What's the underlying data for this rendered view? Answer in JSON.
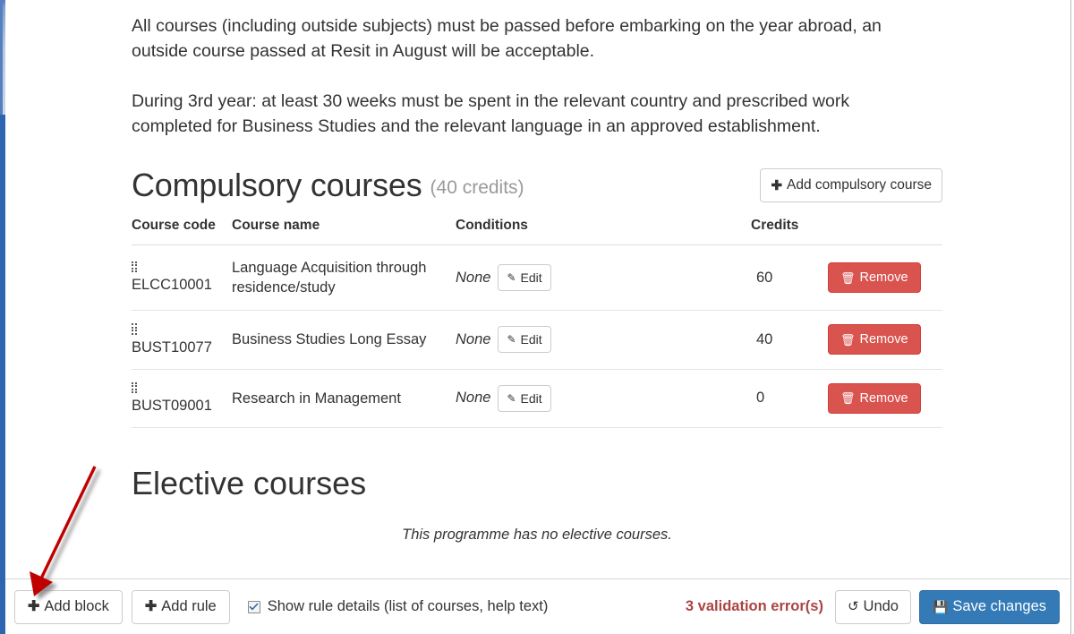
{
  "paragraphs": [
    "All courses (including outside subjects) must be passed before embarking on the year abroad, an outside course passed at Resit in August will be acceptable.",
    "During 3rd year: at least 30 weeks must be spent in the relevant country and prescribed work completed for Business Studies and the relevant language in an approved establishment."
  ],
  "compulsory": {
    "title": "Compulsory courses",
    "credits_label": "(40 credits)",
    "add_button": "Add compulsory course",
    "add_icon": "plus-icon",
    "columns": [
      "Course code",
      "Course name",
      "Conditions",
      "Credits"
    ],
    "rows": [
      {
        "code": "ELCC10001",
        "name": "Language Acquisition through residence/study",
        "condition": "None",
        "edit_label": "Edit",
        "credits": "60",
        "remove_label": "Remove"
      },
      {
        "code": "BUST10077",
        "name": "Business Studies Long Essay",
        "condition": "None",
        "edit_label": "Edit",
        "credits": "40",
        "remove_label": "Remove"
      },
      {
        "code": "BUST09001",
        "name": "Research in Management",
        "condition": "None",
        "edit_label": "Edit",
        "credits": "0",
        "remove_label": "Remove"
      }
    ]
  },
  "elective": {
    "title": "Elective courses",
    "empty_message": "This programme has no elective courses."
  },
  "footer": {
    "add_block": "Add block",
    "add_rule": "Add rule",
    "show_details_label": "Show rule details (list of courses, help text)",
    "show_details_checked": true,
    "validation": "3 validation error(s)",
    "undo": "Undo",
    "save": "Save changes"
  },
  "colors": {
    "danger": "#d9534f",
    "primary": "#337ab7",
    "validation_text": "#a94442",
    "muted": "#9a9a9a",
    "annotation_arrow": "#c00000",
    "left_rail": "#2f64b0"
  },
  "annotation": {
    "type": "arrow",
    "points_to": "add-block-button"
  }
}
